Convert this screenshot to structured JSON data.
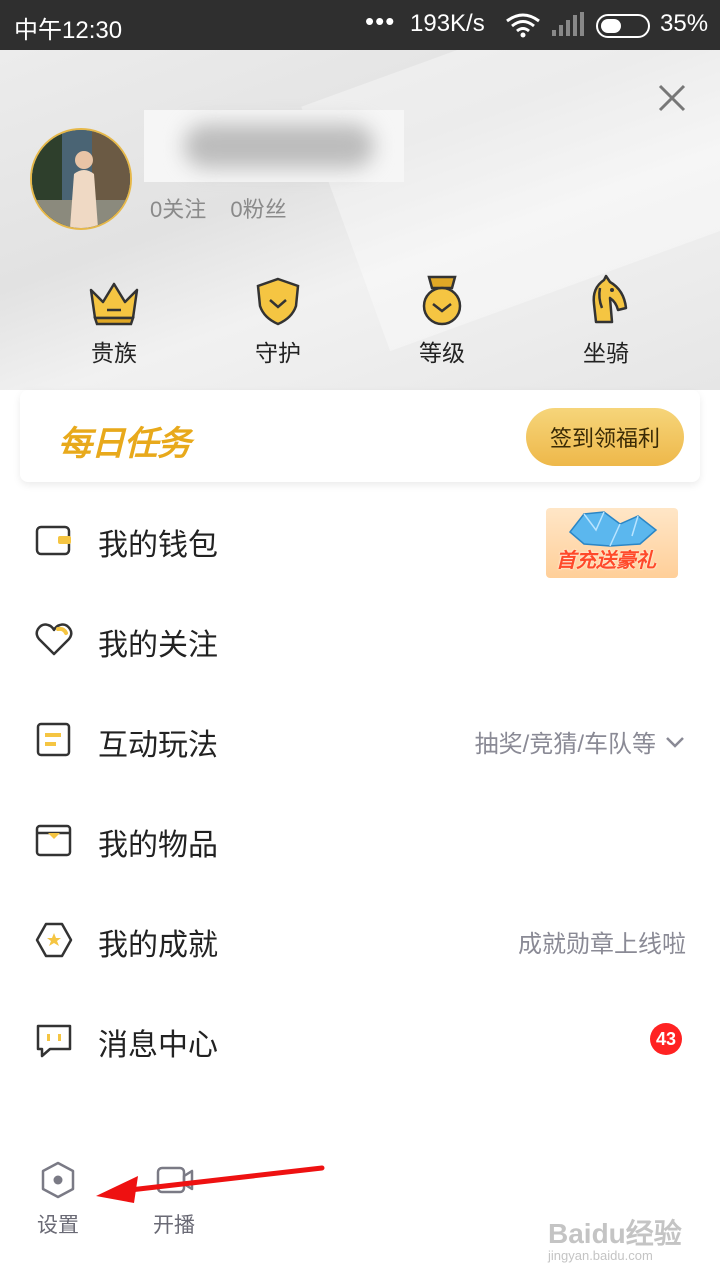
{
  "status_bar": {
    "time": "中午12:30",
    "dots": "•••",
    "speed": "193K/s",
    "battery": "35%"
  },
  "profile": {
    "following": "0关注",
    "fans": "0粉丝"
  },
  "badges": [
    {
      "label": "贵族",
      "icon": "crown-icon"
    },
    {
      "label": "守护",
      "icon": "shield-icon"
    },
    {
      "label": "等级",
      "icon": "medal-icon"
    },
    {
      "label": "坐骑",
      "icon": "horse-icon"
    }
  ],
  "daily_task": {
    "title": "每日任务",
    "button": "签到领福利"
  },
  "promo": {
    "text": "首充送豪礼"
  },
  "menu": [
    {
      "label": "我的钱包",
      "icon": "wallet-icon"
    },
    {
      "label": "我的关注",
      "icon": "heart-icon"
    },
    {
      "label": "互动玩法",
      "hint": "抽奖/竞猜/车队等",
      "icon": "interactive-icon"
    },
    {
      "label": "我的物品",
      "icon": "box-icon"
    },
    {
      "label": "我的成就",
      "hint": "成就勋章上线啦",
      "icon": "achievement-icon"
    },
    {
      "label": "消息中心",
      "badge": "43",
      "icon": "message-icon"
    }
  ],
  "bottom": {
    "settings": "设置",
    "broadcast": "开播"
  },
  "watermark": {
    "main": "Baidu经验",
    "sub": "jingyan.baidu.com"
  },
  "colors": {
    "accent_gold": "#e8a91b",
    "badge_red": "#ff2222",
    "arrow_red": "#ee1111"
  }
}
